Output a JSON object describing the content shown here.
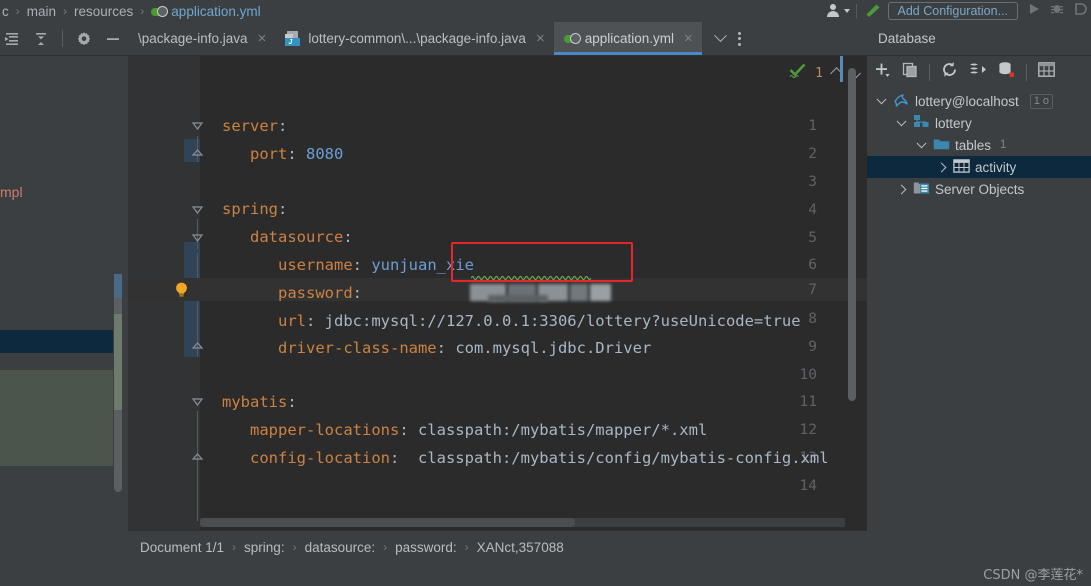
{
  "window": {
    "theme_bg": "#3c3f41",
    "editor_bg": "#2b2b2b",
    "accent": "#4a88c7"
  },
  "nav_breadcrumb": {
    "items": [
      {
        "label": "c",
        "kind": "text"
      },
      {
        "label": "main",
        "kind": "text"
      },
      {
        "label": "resources",
        "kind": "text"
      },
      {
        "label": "application.yml",
        "kind": "file",
        "icon": "yaml-file-icon"
      }
    ],
    "separator": "›"
  },
  "run_toolbar": {
    "avatar_icon": "user-avatar-icon",
    "avatar_caret_icon": "caret-down-icon",
    "build_icon": "hammer-icon",
    "add_configuration_label": "Add Configuration...",
    "run_icon": "run-play-icon",
    "debug_icon": "debug-bug-icon",
    "stop_icon": "stop-icon"
  },
  "left_tool_icons": [
    {
      "name": "expand-all-icon",
      "label": "Expand All"
    },
    {
      "name": "collapse-all-icon",
      "label": "Collapse All"
    },
    {
      "name": "settings-gear-icon",
      "label": "Settings"
    },
    {
      "name": "hide-panel-icon",
      "label": "Hide"
    }
  ],
  "editor_tabs": {
    "tabs": [
      {
        "label": "\\package-info.java",
        "icon": "java-file-icon",
        "active": false,
        "show_icon": false,
        "closable": true
      },
      {
        "label": "lottery-common\\...\\package-info.java",
        "icon": "java-file-icon",
        "active": false,
        "show_icon": true,
        "closable": true
      },
      {
        "label": "application.yml",
        "icon": "yaml-file-icon",
        "active": true,
        "show_icon": true,
        "closable": true
      }
    ],
    "close_glyph": "×",
    "overflow_icon": "chevron-down-icon",
    "options_icon": "kebab-menu-icon"
  },
  "editor": {
    "filename": "application.yml",
    "lines": [
      {
        "num": "1",
        "indent": 0,
        "tokens": [
          {
            "t": "server",
            "c": "k"
          },
          {
            "t": ":",
            "c": "p"
          }
        ],
        "fold": "start"
      },
      {
        "num": "2",
        "indent": 2,
        "tokens": [
          {
            "t": "port",
            "c": "k"
          },
          {
            "t": ": ",
            "c": "p"
          },
          {
            "t": "8080",
            "c": "v"
          }
        ],
        "fold": "end"
      },
      {
        "num": "3",
        "indent": 0,
        "tokens": [],
        "fold": "none"
      },
      {
        "num": "4",
        "indent": 0,
        "tokens": [
          {
            "t": "spring",
            "c": "k"
          },
          {
            "t": ":",
            "c": "p"
          }
        ],
        "fold": "start"
      },
      {
        "num": "5",
        "indent": 2,
        "tokens": [
          {
            "t": "datasource",
            "c": "k"
          },
          {
            "t": ":",
            "c": "p"
          }
        ],
        "fold": "start"
      },
      {
        "num": "6",
        "indent": 4,
        "tokens": [
          {
            "t": "username",
            "c": "k"
          },
          {
            "t": ": ",
            "c": "p"
          },
          {
            "t": "yunjuan_xie",
            "c": "v"
          }
        ],
        "fold": "none"
      },
      {
        "num": "7",
        "indent": 4,
        "tokens": [
          {
            "t": "password",
            "c": "k"
          },
          {
            "t": ":",
            "c": "p"
          }
        ],
        "fold": "none",
        "bulb": true,
        "masked_value": true
      },
      {
        "num": "8",
        "indent": 4,
        "tokens": [
          {
            "t": "url",
            "c": "k"
          },
          {
            "t": ": ",
            "c": "p"
          },
          {
            "t": "jdbc:mysql://127.0.0.1:3306/lottery?useUnicode=true",
            "c": "s"
          }
        ],
        "fold": "none"
      },
      {
        "num": "9",
        "indent": 4,
        "tokens": [
          {
            "t": "driver-class-name",
            "c": "k"
          },
          {
            "t": ": ",
            "c": "p"
          },
          {
            "t": "com.mysql.jdbc.Driver",
            "c": "s"
          }
        ],
        "fold": "end"
      },
      {
        "num": "10",
        "indent": 0,
        "tokens": [],
        "fold": "none"
      },
      {
        "num": "11",
        "indent": 0,
        "tokens": [
          {
            "t": "mybatis",
            "c": "k"
          },
          {
            "t": ":",
            "c": "p"
          }
        ],
        "fold": "start"
      },
      {
        "num": "12",
        "indent": 2,
        "tokens": [
          {
            "t": "mapper-locations",
            "c": "k"
          },
          {
            "t": ": ",
            "c": "p"
          },
          {
            "t": "classpath:/mybatis/mapper/*.xml",
            "c": "s"
          }
        ],
        "fold": "none"
      },
      {
        "num": "13",
        "indent": 2,
        "tokens": [
          {
            "t": "config-location",
            "c": "k"
          },
          {
            "t": ":  ",
            "c": "p"
          },
          {
            "t": "classpath:/mybatis/config/mybatis-config.xml",
            "c": "s"
          }
        ],
        "fold": "end"
      },
      {
        "num": "14",
        "indent": 0,
        "tokens": [],
        "fold": "none"
      }
    ],
    "annotation": {
      "type": "red-rectangle-highlight",
      "target_text": "yunjuan_xie",
      "color": "#e8262a"
    },
    "squiggle": {
      "color": "#6aa84f",
      "under_text": "yunjuan_xie"
    },
    "bulb_icon": "intention-bulb-icon",
    "masked_password_note": "blurred"
  },
  "inspection_widget": {
    "status_icon": "green-checkmark-icon",
    "count": "1",
    "prev_icon": "chevron-up-icon",
    "next_icon": "chevron-down-icon"
  },
  "database_panel": {
    "title": "Database",
    "toolbar": [
      {
        "name": "add-data-source-icon",
        "label": "New"
      },
      {
        "name": "duplicate-icon",
        "label": "Duplicate"
      },
      {
        "name": "refresh-icon",
        "label": "Refresh"
      },
      {
        "name": "run-query-icon",
        "label": "Jump to Query Console"
      },
      {
        "name": "db-sync-icon",
        "label": "Synchronize"
      },
      {
        "name": "table-grid-icon",
        "label": "Open Table Editor"
      }
    ],
    "tree": [
      {
        "label": "lottery@localhost",
        "icon": "mysql-dolphin-icon",
        "depth": 0,
        "twisty": "down",
        "selected": false,
        "chip": "1 o"
      },
      {
        "label": "lottery",
        "icon": "schema-icon",
        "depth": 1,
        "twisty": "down",
        "selected": false
      },
      {
        "label": "tables",
        "icon": "folder-icon",
        "depth": 2,
        "twisty": "down",
        "selected": false,
        "count": "1"
      },
      {
        "label": "activity",
        "icon": "table-icon",
        "depth": 3,
        "twisty": "right",
        "selected": true
      },
      {
        "label": "Server Objects",
        "icon": "server-objects-icon",
        "depth": 1,
        "twisty": "right",
        "selected": false
      }
    ]
  },
  "project_sliver": {
    "truncated_label": "mpl",
    "truncated_label_color": "#cf7c6b"
  },
  "status_breadcrumb": {
    "items": [
      "Document 1/1",
      "spring:",
      "datasource:",
      "password:",
      "XANct,357088"
    ],
    "separator": "›"
  },
  "watermark": {
    "text": "CSDN @李莲花*"
  }
}
